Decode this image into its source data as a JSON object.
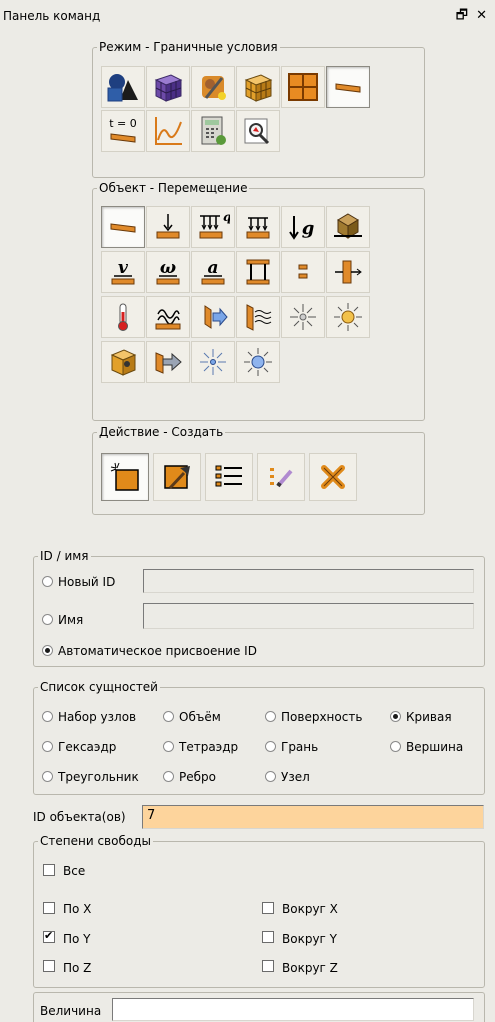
{
  "panel": {
    "title": "Панель команд",
    "window_icons": "🗗 ✕"
  },
  "mode_group": {
    "legend": "Режим - Граничные условия",
    "buttons": [
      {
        "icon": "geometry-icon",
        "pressed": false
      },
      {
        "icon": "mesh-icon",
        "pressed": false
      },
      {
        "icon": "material-icon",
        "pressed": false
      },
      {
        "icon": "elements-icon",
        "pressed": false
      },
      {
        "icon": "grid-icon",
        "pressed": false
      },
      {
        "icon": "boundary-conditions-icon",
        "pressed": true
      },
      {
        "icon": "initial-conditions-icon",
        "label": "t = 0",
        "pressed": false
      },
      {
        "icon": "graph-icon",
        "pressed": false
      },
      {
        "icon": "calculator-icon",
        "pressed": false
      },
      {
        "icon": "results-icon",
        "pressed": false
      }
    ]
  },
  "object_group": {
    "legend": "Объект - Перемещение",
    "buttons": [
      {
        "icon": "displacement-icon",
        "pressed": true
      },
      {
        "icon": "force-icon"
      },
      {
        "icon": "distributed-load-icon",
        "label": "q"
      },
      {
        "icon": "pressure-icon"
      },
      {
        "icon": "gravity-icon",
        "label": "g"
      },
      {
        "icon": "centrifugal-icon"
      },
      {
        "icon": "velocity-icon",
        "label": "v"
      },
      {
        "icon": "angular-velocity-icon",
        "label": "ω"
      },
      {
        "icon": "acceleration-icon",
        "label": "a"
      },
      {
        "icon": "constraint-icon"
      },
      {
        "icon": "contact-icon"
      },
      {
        "icon": "bolt-icon"
      },
      {
        "icon": "temperature-icon"
      },
      {
        "icon": "convection-icon"
      },
      {
        "icon": "heat-flux-icon"
      },
      {
        "icon": "radiation-icon"
      },
      {
        "icon": "heat-source-icon"
      },
      {
        "icon": "heat-generation-icon"
      },
      {
        "icon": "volume-heat-icon"
      },
      {
        "icon": "surface-flux-icon"
      },
      {
        "icon": "point-source-icon"
      },
      {
        "icon": "point-generation-icon"
      }
    ]
  },
  "action_group": {
    "legend": "Действие - Создать",
    "buttons": [
      {
        "icon": "create-icon",
        "pressed": true
      },
      {
        "icon": "edit-icon"
      },
      {
        "icon": "list-icon"
      },
      {
        "icon": "modify-icon"
      },
      {
        "icon": "delete-icon"
      }
    ]
  },
  "id_group": {
    "legend": "ID / имя",
    "new_id_label": "Новый ID",
    "new_id_value": "",
    "name_label": "Имя",
    "name_value": "",
    "auto_label": "Автоматическое присвоение ID",
    "selected": "auto"
  },
  "entity_group": {
    "legend": "Список сущностей",
    "options": [
      {
        "label": "Набор узлов",
        "selected": false
      },
      {
        "label": "Объём",
        "selected": false
      },
      {
        "label": "Поверхность",
        "selected": false
      },
      {
        "label": "Кривая",
        "selected": true
      },
      {
        "label": "Гексаэдр",
        "selected": false
      },
      {
        "label": "Тетраэдр",
        "selected": false
      },
      {
        "label": "Грань",
        "selected": false
      },
      {
        "label": "Вершина",
        "selected": false
      },
      {
        "label": "Треугольник",
        "selected": false
      },
      {
        "label": "Ребро",
        "selected": false
      },
      {
        "label": "Узел",
        "selected": false
      }
    ]
  },
  "object_ids": {
    "label": "ID объекта(ов)",
    "value": "7"
  },
  "dof_group": {
    "legend": "Степени свободы",
    "all_label": "Все",
    "all_checked": false,
    "items": [
      {
        "label": "По X",
        "checked": false
      },
      {
        "label": "Вокруг X",
        "checked": false
      },
      {
        "label": "По Y",
        "checked": true
      },
      {
        "label": "Вокруг Y",
        "checked": false
      },
      {
        "label": "По Z",
        "checked": false
      },
      {
        "label": "Вокруг Z",
        "checked": false
      }
    ]
  },
  "magnitude": {
    "label": "Величина",
    "value": ""
  }
}
